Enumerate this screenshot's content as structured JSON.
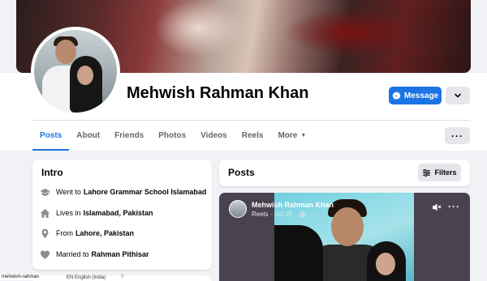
{
  "profile": {
    "name": "Mehwish Rahman Khan"
  },
  "actions": {
    "message_label": "Message"
  },
  "tabs": [
    {
      "label": "Posts",
      "active": true
    },
    {
      "label": "About"
    },
    {
      "label": "Friends"
    },
    {
      "label": "Photos"
    },
    {
      "label": "Videos"
    },
    {
      "label": "Reels"
    },
    {
      "label": "More"
    }
  ],
  "intro": {
    "title": "Intro",
    "items": [
      {
        "icon": "graduation-cap-icon",
        "prefix": "Went to",
        "value": "Lahore Grammar School Islamabad"
      },
      {
        "icon": "home-icon",
        "prefix": "Lives in",
        "value": "Islamabad, Pakistan"
      },
      {
        "icon": "location-pin-icon",
        "prefix": "From",
        "value": "Lahore, Pakistan"
      },
      {
        "icon": "heart-icon",
        "prefix": "Married to",
        "value": "Rahman Pithisar"
      }
    ]
  },
  "posts": {
    "title": "Posts",
    "filters_label": "Filters"
  },
  "reel": {
    "author": "Mehwish Rahman Khan",
    "type": "Reels",
    "date": "Jul 20"
  },
  "taskbar": {
    "left_text": "mehwish-rahman",
    "lang": "EN English (India)",
    "mark": "⁝⁝"
  },
  "colors": {
    "accent": "#1b74e4",
    "background": "#f0f2f5",
    "card": "#ffffff",
    "secondary_button": "#e4e6eb"
  }
}
